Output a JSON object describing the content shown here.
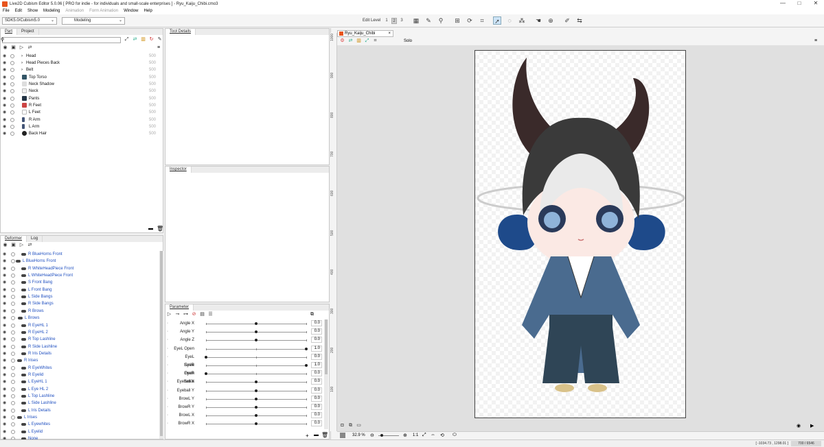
{
  "app": {
    "title": "Live2D Cubism Editor 5.0.06   [ PRO for indie - for individuals and small-scale enterprises ]   - Ryu_Kaiju_Chibi.cmo3",
    "minimize": "—",
    "maximize": "□",
    "close": "✕"
  },
  "menu": [
    {
      "label": "File",
      "enabled": true
    },
    {
      "label": "Edit",
      "enabled": true
    },
    {
      "label": "Show",
      "enabled": true
    },
    {
      "label": "Modeling",
      "enabled": true
    },
    {
      "label": "Animation",
      "enabled": false
    },
    {
      "label": "Form Animation",
      "enabled": false
    },
    {
      "label": "Window",
      "enabled": true
    },
    {
      "label": "Help",
      "enabled": true
    }
  ],
  "toolbar": {
    "sdk_select": "SDK5.0/Cubism5.0",
    "mode_select": "Modeling",
    "edit_level_label": "Edit Level",
    "levels": [
      "1",
      "2",
      "3"
    ],
    "active_level": "2"
  },
  "part_panel": {
    "tabs": [
      "Part",
      "Project"
    ],
    "active_tab": "Part",
    "search": {
      "value": "",
      "placeholder": ""
    },
    "items": [
      {
        "name": "Head",
        "value": "500",
        "folder": true
      },
      {
        "name": "Head Pieces Back",
        "value": "500",
        "folder": true
      },
      {
        "name": "Belt",
        "value": "500",
        "folder": true
      },
      {
        "name": "Top Torso",
        "value": "500",
        "folder": false
      },
      {
        "name": "Neck Shadow",
        "value": "500",
        "folder": false
      },
      {
        "name": "Neck",
        "value": "500",
        "folder": false
      },
      {
        "name": "Pants",
        "value": "500",
        "folder": false
      },
      {
        "name": "R Feet",
        "value": "500",
        "folder": false
      },
      {
        "name": "L Feet",
        "value": "500",
        "folder": false
      },
      {
        "name": "R Arm",
        "value": "500",
        "folder": false
      },
      {
        "name": "L Arm",
        "value": "500",
        "folder": false
      },
      {
        "name": "Back Hair",
        "value": "500",
        "folder": false
      }
    ]
  },
  "deformer_panel": {
    "tabs": [
      "Deformer",
      "Log"
    ],
    "active_tab": "Deformer",
    "items": [
      "R BlueHorns Front",
      "L BlueHorns Front",
      "R WhiteHeadPiece Front",
      "L WhiteHeadPiece Front",
      "S Front Bang",
      "L Front Bang",
      "L Side Bangs",
      "R Side Bangs",
      "R Brows",
      "L Brows",
      "R EyeHL 1",
      "R EyeHL 2",
      "R Top Lashline",
      "R Side Lashline",
      "R Iris Details",
      "R Irises",
      "R EyeWhites",
      "R Eyelid",
      "L EyeHL 1",
      "L Eye HL 2",
      "L Top Lashline",
      "L Side Lashline",
      "L Iris Details",
      "L Irises",
      "L Eyewhites",
      "L Eyelid",
      "None"
    ]
  },
  "tool_details": {
    "title": "Tool Details"
  },
  "inspector": {
    "title": "Inspector"
  },
  "parameter_panel": {
    "title": "Parameter",
    "params": [
      {
        "name": "Angle X",
        "value": "0.0",
        "level": 0.5
      },
      {
        "name": "Angle Y",
        "value": "0.0",
        "level": 0.5
      },
      {
        "name": "Angle Z",
        "value": "0.0",
        "level": 0.5
      },
      {
        "name": "EyeL Open",
        "value": "1.0",
        "level": 1.0
      },
      {
        "name": "EyeL Smile",
        "value": "0.0",
        "level": 0.0
      },
      {
        "name": "EyeR Open",
        "value": "1.0",
        "level": 1.0
      },
      {
        "name": "EyeR Smile",
        "value": "0.0",
        "level": 0.0
      },
      {
        "name": "Eyeball X",
        "value": "0.0",
        "level": 0.5
      },
      {
        "name": "Eyeball Y",
        "value": "0.0",
        "level": 0.5
      },
      {
        "name": "BrowL Y",
        "value": "0.0",
        "level": 0.5
      },
      {
        "name": "BrowR Y",
        "value": "0.0",
        "level": 0.5
      },
      {
        "name": "BrowL X",
        "value": "0.0",
        "level": 0.5
      },
      {
        "name": "BrowR X",
        "value": "0.0",
        "level": 0.5
      }
    ]
  },
  "canvas": {
    "tab_title": "Ryu_Kaiju_Chibi",
    "tab_close": "×",
    "solo_label": "Solo",
    "ruler_labels": [
      "1000",
      "900",
      "800",
      "700",
      "600",
      "500",
      "400",
      "300",
      "200",
      "100"
    ],
    "zoom": "32.9 %",
    "ratio": "1:1"
  },
  "status": {
    "coords": "[ -1034.73 , 1298.01 ]",
    "zoom_box": "700 / 6546"
  },
  "colors": {
    "accent": "#2050c0",
    "horn_dark": "#3a2a2a",
    "horn_blue": "#1e4a8a",
    "kimono": "#4a6b8f",
    "hakama": "#2f4556",
    "hair": "#3a3a3a"
  }
}
